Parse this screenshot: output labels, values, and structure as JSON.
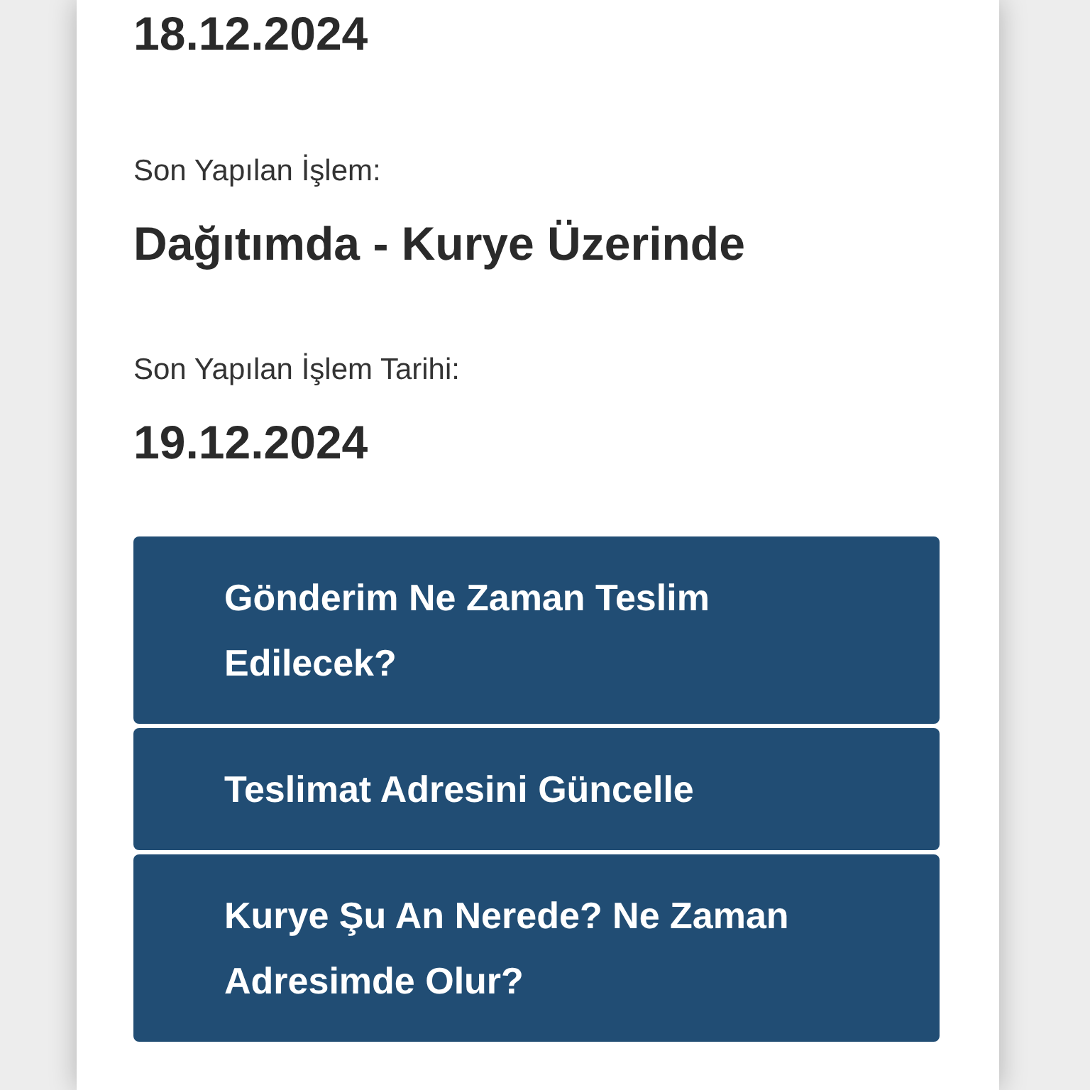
{
  "fields": [
    {
      "value": "18.12.2024"
    },
    {
      "label": "Son Yapılan İşlem:",
      "value": "Dağıtımda - Kurye Üzerinde"
    },
    {
      "label": "Son Yapılan İşlem Tarihi:",
      "value": "19.12.2024"
    }
  ],
  "actions": [
    {
      "label": "Gönderim Ne Zaman Teslim Edilecek?"
    },
    {
      "label": "Teslimat Adresini Güncelle"
    },
    {
      "label": "Kurye Şu An Nerede? Ne Zaman Adresimde Olur?"
    }
  ]
}
